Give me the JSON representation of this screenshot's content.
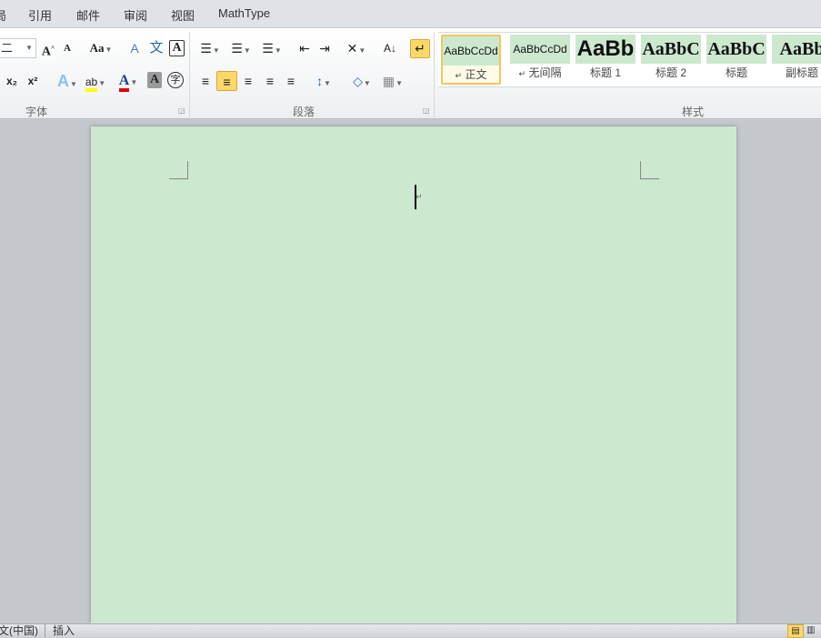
{
  "tabs": [
    "局",
    "引用",
    "邮件",
    "审阅",
    "视图",
    "MathType"
  ],
  "font_group": {
    "label": "字体",
    "font_size": "二",
    "grow": "A",
    "shrink": "A",
    "change_case": "Aa",
    "clear_format": "A",
    "phonetic": "文",
    "border_char": "A",
    "subscript": "x₂",
    "superscript": "x²",
    "text_effect": "A",
    "highlight": "ab",
    "font_color": "A",
    "char_shading": "A",
    "enclose": "字",
    "highlight_color": "#ffff00",
    "font_color_value": "#e00000"
  },
  "paragraph_group": {
    "label": "段落",
    "bullets": "☰",
    "numbering": "☰",
    "multilevel": "☰",
    "decrease_indent": "⇤",
    "increase_indent": "⇥",
    "chinese_layout": "✕",
    "sort": "A↓",
    "show_marks": "↵",
    "align_left": "≡",
    "align_center": "≡",
    "align_right": "≡",
    "justify": "≡",
    "distributed": "≡",
    "line_spacing": "↕",
    "shading": "◇",
    "borders": "▦"
  },
  "styles_group": {
    "label": "样式",
    "styles": [
      {
        "preview": "AaBbCcDd",
        "name": "正文",
        "mark": "↵",
        "selected": true
      },
      {
        "preview": "AaBbCcDd",
        "name": "无间隔",
        "mark": "↵"
      },
      {
        "preview": "AaBb",
        "name": "标题 1"
      },
      {
        "preview": "AaBbC",
        "name": "标题 2"
      },
      {
        "preview": "AaBbC",
        "name": "标题"
      },
      {
        "preview": "AaBb",
        "name": "副标题"
      }
    ]
  },
  "document": {
    "background": "#cce8cf",
    "paragraph_mark": "↵"
  },
  "status": {
    "language": "文(中国)",
    "mode": "插入"
  }
}
